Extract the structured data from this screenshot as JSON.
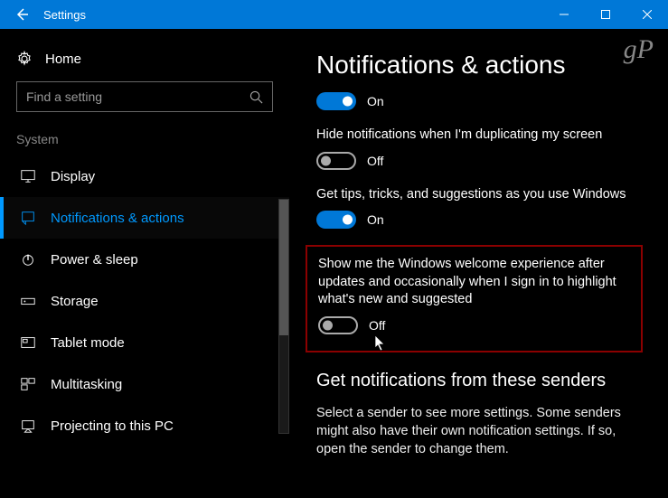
{
  "titlebar": {
    "title": "Settings"
  },
  "sidebar": {
    "home": "Home",
    "search_placeholder": "Find a setting",
    "section": "System",
    "items": [
      {
        "label": "Display"
      },
      {
        "label": "Notifications & actions"
      },
      {
        "label": "Power & sleep"
      },
      {
        "label": "Storage"
      },
      {
        "label": "Tablet mode"
      },
      {
        "label": "Multitasking"
      },
      {
        "label": "Projecting to this PC"
      }
    ]
  },
  "content": {
    "heading": "Notifications & actions",
    "settings": [
      {
        "state": "On"
      },
      {
        "label": "Hide notifications when I'm duplicating my screen",
        "state": "Off"
      },
      {
        "label": "Get tips, tricks, and suggestions as you use Windows",
        "state": "On"
      },
      {
        "label": "Show me the Windows welcome experience after updates and occasionally when I sign in to highlight what's new and suggested",
        "state": "Off"
      }
    ],
    "subhead": "Get notifications from these senders",
    "desc": "Select a sender to see more settings. Some senders might also have their own notification settings. If so, open the sender to change them."
  },
  "watermark": "gP"
}
